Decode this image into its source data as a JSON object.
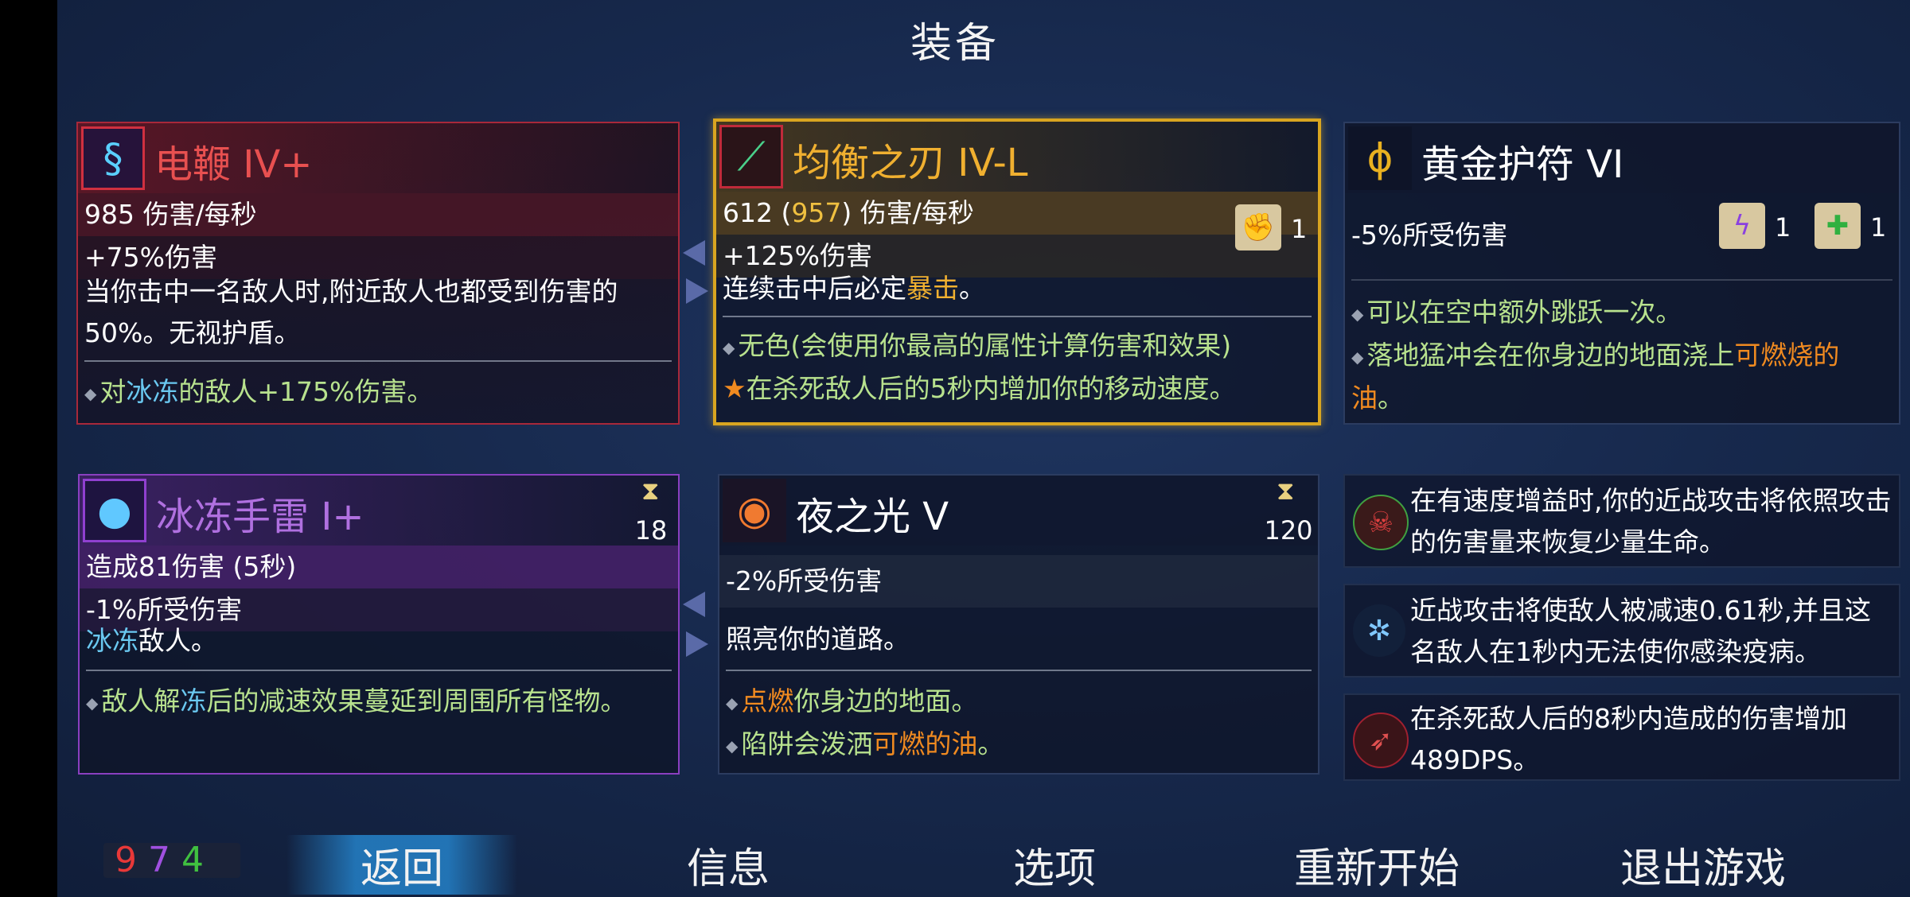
{
  "title": "装备",
  "colors": {
    "red": "#e04848",
    "gold": "#e8a820",
    "purple": "#b070e0",
    "green": "#b8e28e",
    "orange": "#f08a20",
    "blue": "#6ac8f0"
  },
  "cards": {
    "whip": {
      "icon": "electric-whip-icon",
      "name": "电鞭 IV+",
      "stat1": "985 伤害/每秒",
      "stat2": "+75%伤害",
      "desc": "当你击中一名敌人时,附近敌人也都受到伤害的50%。无视护盾。",
      "b1_a": "对",
      "b1_freeze": "冰冻",
      "b1_b": "的敌人+175%伤害。"
    },
    "blade": {
      "icon": "balanced-blade-icon",
      "name": "均衡之刃 IV-L",
      "stat1_a": "612 (",
      "stat1_val": "957",
      "stat1_b": ") 伤害/每秒",
      "stat2": "+125%伤害",
      "desc_a": "连续击中后必定",
      "desc_crit": "暴击",
      "desc_b": "。",
      "scroll_count": "1",
      "b1": "无色(会使用你最高的属性计算伤害和效果)",
      "b2": "在杀死敌人后的5秒内增加你的移动速度。"
    },
    "amulet": {
      "icon": "golden-amulet-icon",
      "name": "黄金护符 VI",
      "stat1": "-5%所受伤害",
      "scroll1_count": "1",
      "scroll2_count": "1",
      "b1": "可以在空中额外跳跃一次。",
      "b2_a": "落地猛冲会在你身边的地面浇上",
      "b2_oil": "可燃烧的油",
      "b2_b": "。"
    },
    "grenade": {
      "icon": "freeze-grenade-icon",
      "name": "冰冻手雷 I+",
      "cooldown": "18",
      "stat1": "造成81伤害 (5秒)",
      "stat2": "-1%所受伤害",
      "desc_freeze": "冰冻",
      "desc_b": "敌人。",
      "b1_a": "敌人解",
      "b1_freeze": "冻",
      "b1_b": "后的减速效果蔓延到周围所有怪物。"
    },
    "nightlight": {
      "icon": "night-light-icon",
      "name": "夜之光 V",
      "cooldown": "120",
      "stat1": "-2%所受伤害",
      "desc": "照亮你的道路。",
      "b1_ignite": "点燃",
      "b1_b": "你身边的地面。",
      "b2_a": "陷阱会泼洒",
      "b2_oil": "可燃的油",
      "b2_b": "。"
    }
  },
  "effects": [
    {
      "icon": "skull-heal-icon",
      "text": "在有速度增益时,你的近战攻击将依照攻击的伤害量来恢复少量生命。"
    },
    {
      "icon": "frost-scythe-icon",
      "text": "近战攻击将使敌人被减速0.61秒,并且这名敌人在1秒内无法使你感染疫病。"
    },
    {
      "icon": "crossbow-damage-icon",
      "text": "在杀死敌人后的8秒内造成的伤害增加489DPS。"
    }
  ],
  "stats": {
    "brutality": "9",
    "tactics": "7",
    "survival": "4"
  },
  "menu": {
    "back": "返回",
    "info": "信息",
    "options": "选项",
    "restart": "重新开始",
    "quit": "退出游戏"
  }
}
